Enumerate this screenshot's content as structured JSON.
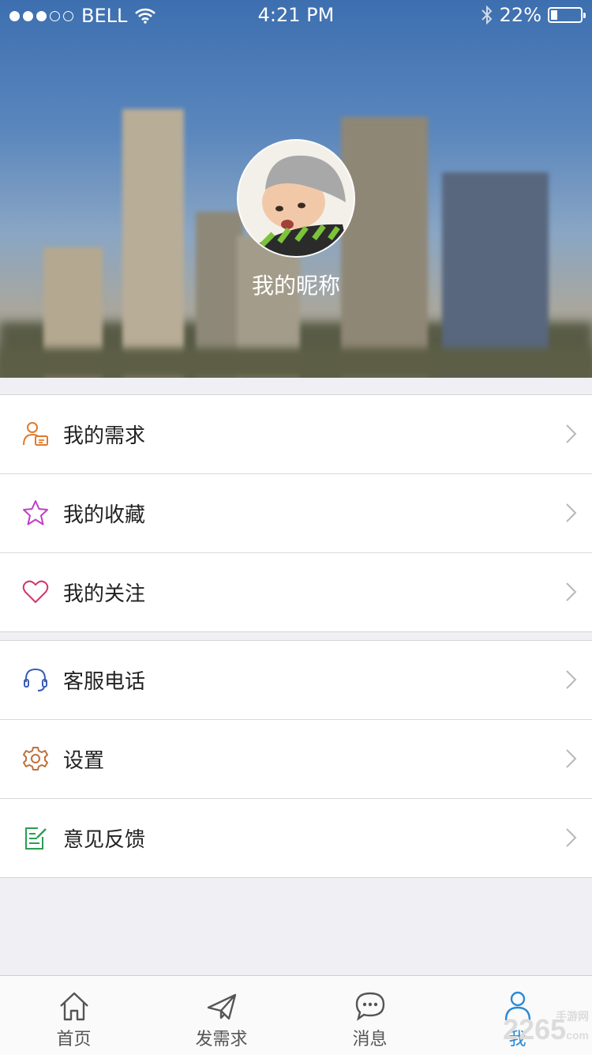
{
  "status_bar": {
    "carrier": "BELL",
    "time": "4:21 PM",
    "battery_percent": "22%",
    "battery_level": 0.22
  },
  "profile": {
    "nickname": "我的昵称"
  },
  "menu_groups": [
    [
      {
        "label": "我的需求",
        "icon": "user-document-icon",
        "color": "#e07a2c"
      },
      {
        "label": "我的收藏",
        "icon": "star-icon",
        "color": "#c23ec9"
      },
      {
        "label": "我的关注",
        "icon": "heart-icon",
        "color": "#d0386a"
      }
    ],
    [
      {
        "label": "客服电话",
        "icon": "headset-icon",
        "color": "#3b5db3"
      },
      {
        "label": "设置",
        "icon": "gear-icon",
        "color": "#c0703a"
      },
      {
        "label": "意见反馈",
        "icon": "feedback-edit-icon",
        "color": "#2a9e52"
      }
    ]
  ],
  "tab_bar": [
    {
      "label": "首页",
      "icon": "home-icon",
      "active": false
    },
    {
      "label": "发需求",
      "icon": "send-icon",
      "active": false
    },
    {
      "label": "消息",
      "icon": "chat-icon",
      "active": false
    },
    {
      "label": "我",
      "icon": "person-icon",
      "active": true
    }
  ],
  "colors": {
    "active_tab": "#2a8ad6",
    "inactive_tab": "#555555"
  },
  "watermark": {
    "main": "2265",
    "suffix": "com",
    "sub": "手游网"
  }
}
